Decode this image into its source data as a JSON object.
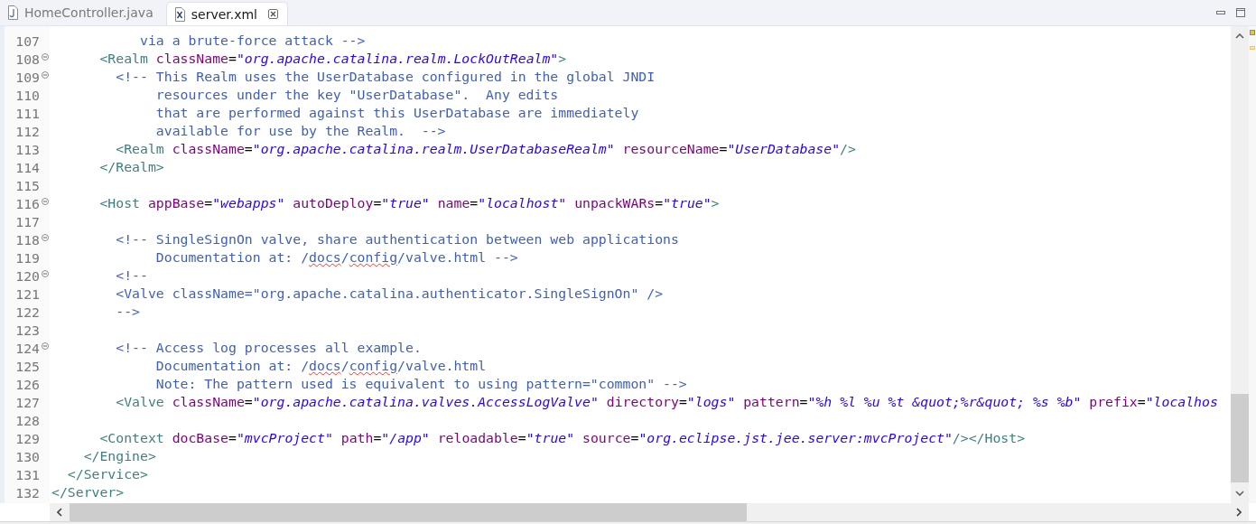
{
  "tabs": [
    {
      "label": "HomeController.java",
      "kind": "java",
      "selected": false,
      "closable": false
    },
    {
      "label": "server.xml",
      "kind": "xml",
      "selected": true,
      "closable": true
    }
  ],
  "editor": {
    "lines": [
      {
        "number": "107",
        "fold": false,
        "segments": [
          {
            "kind": "comment",
            "text": "           via a brute-force attack -->"
          }
        ]
      },
      {
        "number": "108",
        "fold": true,
        "segments": [
          {
            "kind": "tag",
            "text": "      <Realm"
          },
          {
            "kind": "attr",
            "text": " className"
          },
          {
            "kind": "eq",
            "text": "="
          },
          {
            "kind": "value",
            "text": "\"org.apache.catalina.realm.LockOutRealm\""
          },
          {
            "kind": "tag",
            "text": ">"
          }
        ]
      },
      {
        "number": "109",
        "fold": true,
        "segments": [
          {
            "kind": "comment",
            "text": "        <!-- This Realm uses the UserDatabase configured in the global JNDI"
          }
        ]
      },
      {
        "number": "110",
        "fold": false,
        "segments": [
          {
            "kind": "comment",
            "text": "             resources under the key \"UserDatabase\".  Any edits"
          }
        ]
      },
      {
        "number": "111",
        "fold": false,
        "segments": [
          {
            "kind": "comment",
            "text": "             that are performed against this UserDatabase are immediately"
          }
        ]
      },
      {
        "number": "112",
        "fold": false,
        "segments": [
          {
            "kind": "comment",
            "text": "             available for use by the Realm.  -->"
          }
        ]
      },
      {
        "number": "113",
        "fold": false,
        "segments": [
          {
            "kind": "tag",
            "text": "        <Realm"
          },
          {
            "kind": "attr",
            "text": " className"
          },
          {
            "kind": "eq",
            "text": "="
          },
          {
            "kind": "value",
            "text": "\"org.apache.catalina.realm.UserDatabaseRealm\""
          },
          {
            "kind": "attr",
            "text": " resourceName"
          },
          {
            "kind": "eq",
            "text": "="
          },
          {
            "kind": "value",
            "text": "\"UserDatabase\""
          },
          {
            "kind": "tag",
            "text": "/>"
          }
        ]
      },
      {
        "number": "114",
        "fold": false,
        "segments": [
          {
            "kind": "tag",
            "text": "      </Realm>"
          }
        ]
      },
      {
        "number": "115",
        "fold": false
      },
      {
        "number": "116",
        "fold": true,
        "segments": [
          {
            "kind": "tag",
            "text": "      <Host"
          },
          {
            "kind": "attr",
            "text": " appBase"
          },
          {
            "kind": "eq",
            "text": "="
          },
          {
            "kind": "value",
            "text": "\"webapps\""
          },
          {
            "kind": "attr",
            "text": " autoDeploy"
          },
          {
            "kind": "eq",
            "text": "="
          },
          {
            "kind": "value",
            "text": "\"true\""
          },
          {
            "kind": "attr",
            "text": " name"
          },
          {
            "kind": "eq",
            "text": "="
          },
          {
            "kind": "value",
            "text": "\"localhost\""
          },
          {
            "kind": "attr",
            "text": " unpackWARs"
          },
          {
            "kind": "eq",
            "text": "="
          },
          {
            "kind": "value",
            "text": "\"true\""
          },
          {
            "kind": "tag",
            "text": ">"
          }
        ]
      },
      {
        "number": "117",
        "fold": false
      },
      {
        "number": "118",
        "fold": true,
        "segments": [
          {
            "kind": "comment",
            "text": "        <!-- SingleSignOn valve, share authentication between web applications"
          }
        ]
      },
      {
        "number": "119",
        "fold": false,
        "segments": [
          {
            "kind": "comment",
            "text": "             Documentation at: /"
          },
          {
            "kind": "misspelled",
            "text": "docs"
          },
          {
            "kind": "comment",
            "text": "/"
          },
          {
            "kind": "misspelled",
            "text": "config"
          },
          {
            "kind": "comment",
            "text": "/valve.html -->"
          }
        ]
      },
      {
        "number": "120",
        "fold": true,
        "segments": [
          {
            "kind": "comment",
            "text": "        <!--"
          }
        ]
      },
      {
        "number": "121",
        "fold": false,
        "segments": [
          {
            "kind": "comment",
            "text": "        <Valve className=\"org.apache.catalina.authenticator.SingleSignOn\" />"
          }
        ]
      },
      {
        "number": "122",
        "fold": false,
        "segments": [
          {
            "kind": "comment",
            "text": "        -->"
          }
        ]
      },
      {
        "number": "123",
        "fold": false
      },
      {
        "number": "124",
        "fold": true,
        "segments": [
          {
            "kind": "comment",
            "text": "        <!-- Access log processes all example."
          }
        ]
      },
      {
        "number": "125",
        "fold": false,
        "segments": [
          {
            "kind": "comment",
            "text": "             Documentation at: /"
          },
          {
            "kind": "misspelled",
            "text": "docs"
          },
          {
            "kind": "comment",
            "text": "/"
          },
          {
            "kind": "misspelled",
            "text": "config"
          },
          {
            "kind": "comment",
            "text": "/valve.html"
          }
        ]
      },
      {
        "number": "126",
        "fold": false,
        "segments": [
          {
            "kind": "comment",
            "text": "             Note: The pattern used is equivalent to using pattern=\"common\" -->"
          }
        ]
      },
      {
        "number": "127",
        "fold": false,
        "segments": [
          {
            "kind": "tag",
            "text": "        <Valve"
          },
          {
            "kind": "attr",
            "text": " className"
          },
          {
            "kind": "eq",
            "text": "="
          },
          {
            "kind": "value",
            "text": "\"org.apache.catalina.valves.AccessLogValve\""
          },
          {
            "kind": "attr",
            "text": " directory"
          },
          {
            "kind": "eq",
            "text": "="
          },
          {
            "kind": "value",
            "text": "\"logs\""
          },
          {
            "kind": "attr",
            "text": " pattern"
          },
          {
            "kind": "eq",
            "text": "="
          },
          {
            "kind": "value",
            "text": "\"%h %l %u %t &quot;%r&quot; %s %b\""
          },
          {
            "kind": "attr",
            "text": " prefix"
          },
          {
            "kind": "eq",
            "text": "="
          },
          {
            "kind": "value",
            "text": "\"localhos"
          }
        ]
      },
      {
        "number": "128",
        "fold": false
      },
      {
        "number": "129",
        "fold": false,
        "segments": [
          {
            "kind": "tag",
            "text": "      <Context"
          },
          {
            "kind": "attr",
            "text": " docBase"
          },
          {
            "kind": "eq",
            "text": "="
          },
          {
            "kind": "value",
            "text": "\"mvcProject\""
          },
          {
            "kind": "attr",
            "text": " path"
          },
          {
            "kind": "eq",
            "text": "="
          },
          {
            "kind": "value",
            "text": "\"/app\""
          },
          {
            "kind": "attr",
            "text": " reloadable"
          },
          {
            "kind": "eq",
            "text": "="
          },
          {
            "kind": "value",
            "text": "\"true\""
          },
          {
            "kind": "attr",
            "text": " source"
          },
          {
            "kind": "eq",
            "text": "="
          },
          {
            "kind": "value",
            "text": "\"org.eclipse.jst.jee.server:mvcProject\""
          },
          {
            "kind": "tag",
            "text": "/></Host>"
          }
        ]
      },
      {
        "number": "130",
        "fold": false,
        "segments": [
          {
            "kind": "tag",
            "text": "    </Engine>"
          }
        ]
      },
      {
        "number": "131",
        "fold": false,
        "segments": [
          {
            "kind": "tag",
            "text": "  </Service>"
          }
        ]
      },
      {
        "number": "132",
        "fold": false,
        "segments": [
          {
            "kind": "tag",
            "text": "</Server>"
          }
        ]
      }
    ]
  }
}
